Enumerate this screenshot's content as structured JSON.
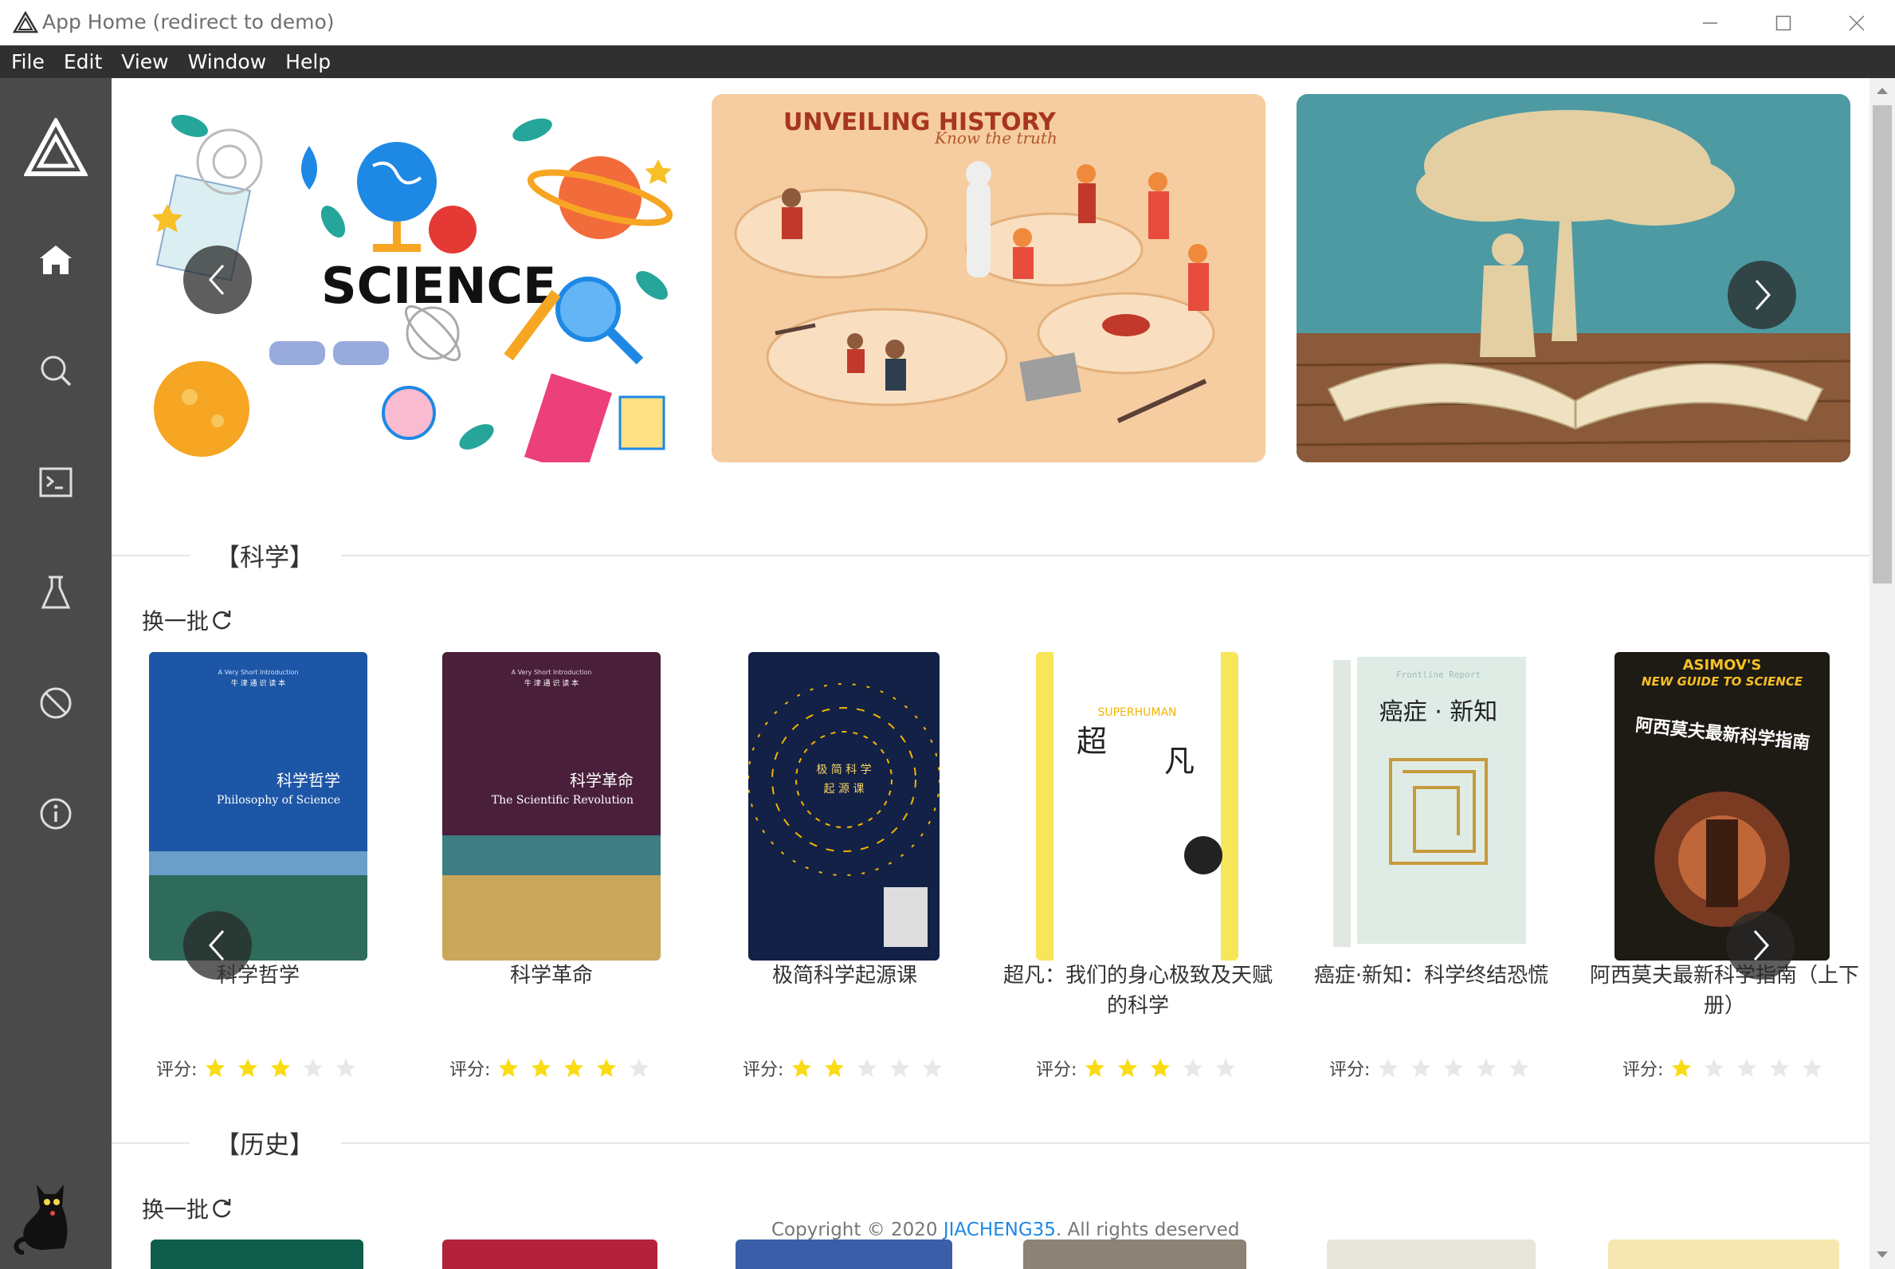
{
  "window": {
    "title": "App Home (redirect to demo)"
  },
  "menu": [
    "File",
    "Edit",
    "View",
    "Window",
    "Help"
  ],
  "sidebar": {
    "items": [
      {
        "icon": "home-icon",
        "active": true
      },
      {
        "icon": "search-icon"
      },
      {
        "icon": "terminal-icon"
      },
      {
        "icon": "flask-icon"
      },
      {
        "icon": "block-icon"
      },
      {
        "icon": "info-icon"
      }
    ]
  },
  "carousel": {
    "slide1": {
      "text": "SCIENCE"
    },
    "slide2": {
      "title": "UNVEILING HISTORY",
      "subtitle": "Know the truth"
    }
  },
  "sections": [
    {
      "title": "【科学】",
      "refresh": "换一批",
      "books": [
        {
          "title": "科学哲学",
          "rating_label": "评分:",
          "stars": 3,
          "cover_line1": "科学哲学",
          "cover_line2": "Philosophy of Science",
          "cover_top": "A Very Short Introduction",
          "cover_series": "牛 津 通 识 读 本"
        },
        {
          "title": "科学革命",
          "rating_label": "评分:",
          "stars": 4,
          "cover_line1": "科学革命",
          "cover_line2": "The Scientific Revolution",
          "cover_top": "A Very Short Introduction",
          "cover_series": "牛 津 通 识 读 本"
        },
        {
          "title": "极简科学起源课",
          "rating_label": "评分:",
          "stars": 2,
          "cover_line1": "极 简 科 学",
          "cover_line2": "起 源 课"
        },
        {
          "title": "超凡：我们的身心极致及天赋的科学",
          "rating_label": "评分:",
          "stars": 3,
          "cover_line1": "超",
          "cover_line2": "凡",
          "cover_top": "SUPERHUMAN"
        },
        {
          "title": "癌症·新知：科学终结恐慌",
          "rating_label": "评分:",
          "stars": 0,
          "cover_line1": "癌症 · 新知",
          "cover_line2": "Frontline Report"
        },
        {
          "title": "阿西莫夫最新科学指南（上下册）",
          "rating_label": "评分:",
          "stars": 1,
          "cover_line1": "ASIMOV'S",
          "cover_line2": "NEW GUIDE TO SCIENCE",
          "cover_line3": "阿西莫夫最新科学指南"
        }
      ]
    },
    {
      "title": "【历史】",
      "refresh": "换一批"
    }
  ],
  "footer": {
    "prefix": "Copyright © 2020 ",
    "brand": "JIACHENG35",
    "suffix": ". All rights deserved"
  },
  "colors": {
    "star_on": "#fadb14",
    "star_off": "#e8e8e8",
    "sidebar": "#4a4a4a",
    "menubar": "#303030"
  }
}
